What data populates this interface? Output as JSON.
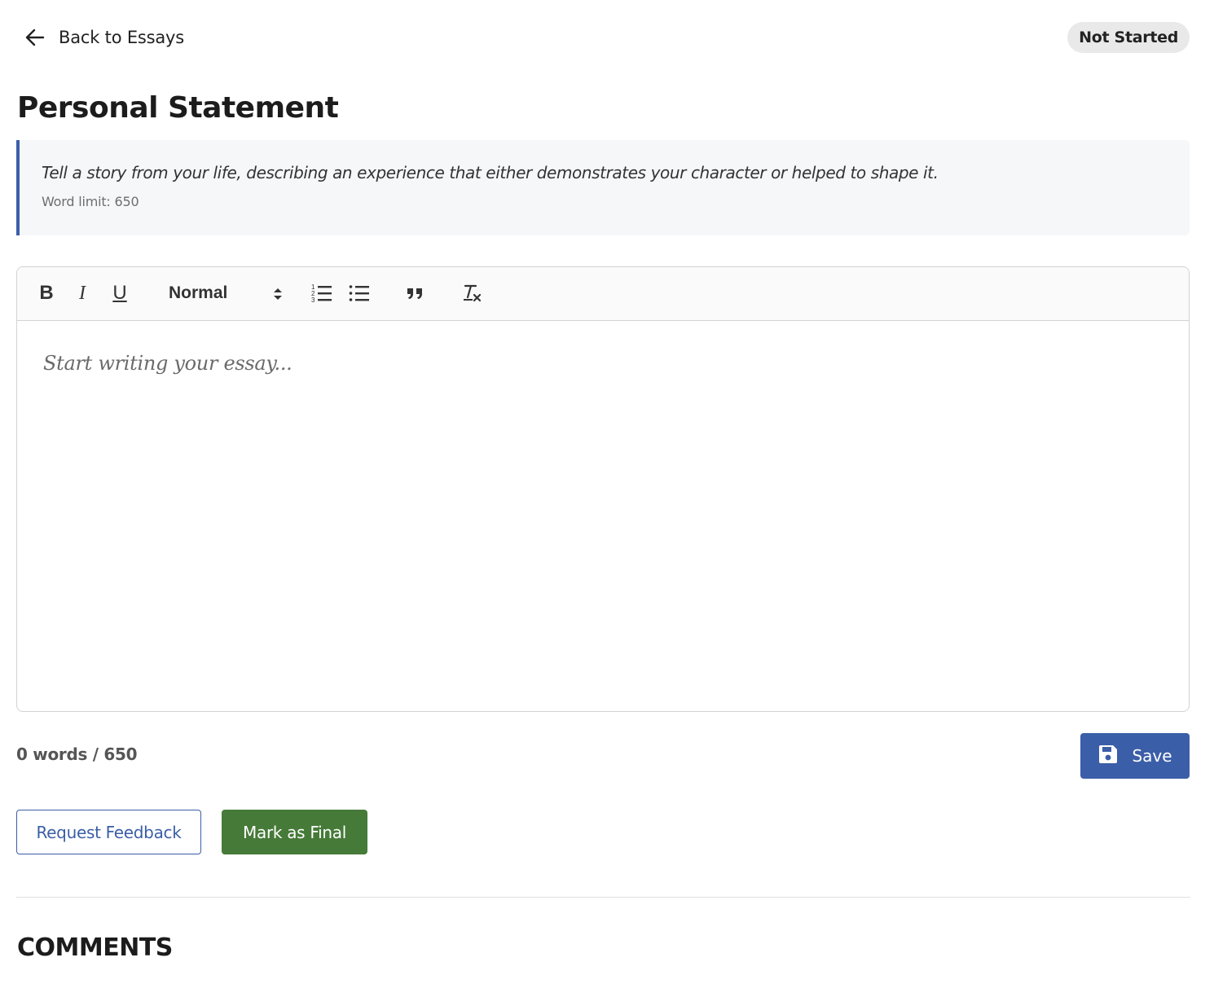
{
  "header": {
    "back_label": "Back to Essays",
    "status_badge": "Not Started"
  },
  "essay": {
    "title": "Personal Statement",
    "prompt": "Tell a story from your life, describing an experience that either demonstrates your character or helped to shape it.",
    "word_limit_label": "Word limit: 650"
  },
  "editor": {
    "toolbar": {
      "bold": "B",
      "italic": "I",
      "underline": "U",
      "format_value": "Normal"
    },
    "placeholder": "Start writing your essay..."
  },
  "footer": {
    "word_count": "0 words / 650",
    "save_label": "Save",
    "request_feedback_label": "Request Feedback",
    "mark_final_label": "Mark as Final"
  },
  "comments": {
    "heading": "COMMENTS"
  },
  "colors": {
    "accent_blue": "#3b5ea8",
    "final_green": "#467a38",
    "badge_bg": "#e9e9e9",
    "prompt_bg": "#f5f7f9"
  },
  "icons": {
    "back": "arrow-left-icon",
    "save": "floppy-disk-icon",
    "ordered_list": "ordered-list-icon",
    "bullet_list": "bullet-list-icon",
    "blockquote": "quote-icon",
    "clear_format": "clear-format-icon",
    "select_caret": "sort-caret-icon"
  }
}
